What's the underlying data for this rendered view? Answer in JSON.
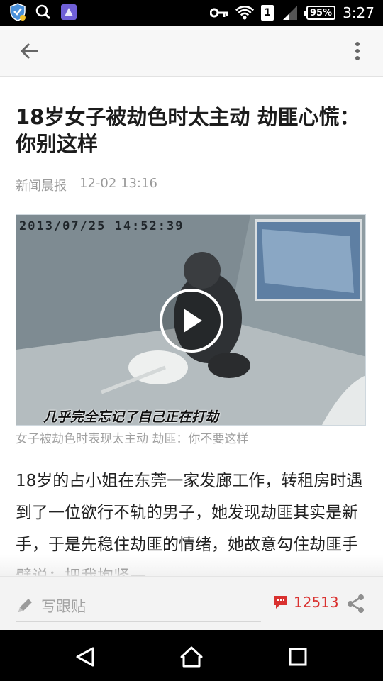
{
  "status_bar": {
    "time": "3:27",
    "battery": "95%",
    "sim": "1",
    "icons": [
      "shield-icon",
      "search-icon",
      "app-icon",
      "key-icon",
      "wifi-icon",
      "signal-icon"
    ]
  },
  "article": {
    "title": "18岁女子被劫色时太主动 劫匪心慌：你别这样",
    "source": "新闻晨报",
    "date": "12-02 13:16",
    "video": {
      "timestamp": "2013/07/25  14:52:39",
      "subtitle": "几乎完全忘记了自己正在打劫"
    },
    "caption": "女子被劫色时表现太主动 劫匪：你不要这样",
    "body": "18岁的占小姐在东莞一家发廊工作，转租房时遇到了一位欲行不轨的男子，她发现劫匪其实是新手，于是先稳住劫匪的情绪，她故意勾住劫匪手臂说：把我抱紧一"
  },
  "bottom_bar": {
    "reply_placeholder": "写跟贴",
    "comment_count": "12513"
  },
  "colors": {
    "accent_red": "#d9312f",
    "status_bg": "#000000",
    "appbar_bg": "#f7f7f7"
  }
}
